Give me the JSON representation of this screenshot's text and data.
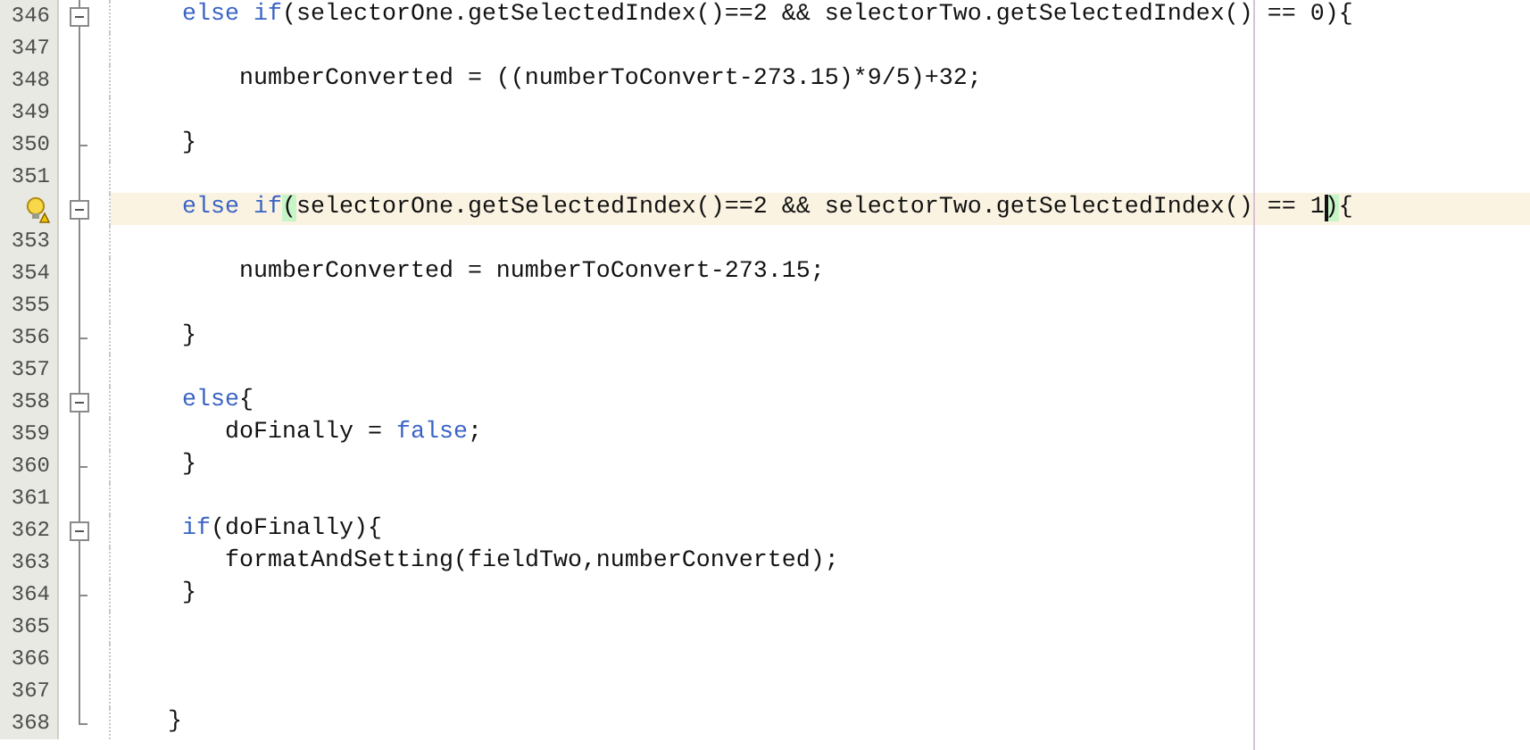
{
  "editor": {
    "lines": [
      {
        "number": "346",
        "expanded": true,
        "code": [
          {
            "text": "     else if",
            "kind": "keyword"
          },
          {
            "text": "(selectorOne.getSelectedIndex()==2 && selectorTwo.getSelectedIndex() == 0){",
            "kind": "plain"
          }
        ]
      },
      {
        "number": "347"
      },
      {
        "number": "348",
        "code": [
          {
            "text": "         numberConverted = ((numberToConvert-273.15)*9/5)+32;",
            "kind": "plain"
          }
        ]
      },
      {
        "number": "349"
      },
      {
        "number": "350",
        "block_end": true,
        "code": [
          {
            "text": "     }",
            "kind": "plain"
          }
        ]
      },
      {
        "number": "351"
      },
      {
        "hint": true,
        "current": true,
        "expanded": true,
        "code": [
          {
            "text": "     else if",
            "kind": "keyword"
          },
          {
            "text": "(",
            "kind": "match",
            "caret": false
          },
          {
            "text": "selectorOne.getSelectedIndex()==2 && selectorTwo.getSelectedIndex() == 1",
            "kind": "plain"
          },
          {
            "text": ")",
            "kind": "match",
            "caret": true
          },
          {
            "text": "{",
            "kind": "plain"
          }
        ]
      },
      {
        "number": "353"
      },
      {
        "number": "354",
        "code": [
          {
            "text": "         numberConverted = numberToConvert-273.15;",
            "kind": "plain"
          }
        ]
      },
      {
        "number": "355"
      },
      {
        "number": "356",
        "block_end": true,
        "code": [
          {
            "text": "     }",
            "kind": "plain"
          }
        ]
      },
      {
        "number": "357"
      },
      {
        "number": "358",
        "expanded": true,
        "code": [
          {
            "text": "     else",
            "kind": "keyword"
          },
          {
            "text": "{",
            "kind": "plain"
          }
        ]
      },
      {
        "number": "359",
        "code": [
          {
            "text": "        doFinally = ",
            "kind": "plain"
          },
          {
            "text": "false",
            "kind": "keyword"
          },
          {
            "text": ";",
            "kind": "plain"
          }
        ]
      },
      {
        "number": "360",
        "block_end": true,
        "code": [
          {
            "text": "     }",
            "kind": "plain"
          }
        ]
      },
      {
        "number": "361"
      },
      {
        "number": "362",
        "expanded": true,
        "code": [
          {
            "text": "     if",
            "kind": "keyword"
          },
          {
            "text": "(doFinally){",
            "kind": "plain"
          }
        ]
      },
      {
        "number": "363",
        "code": [
          {
            "text": "        formatAndSetting(fieldTwo,numberConverted);",
            "kind": "plain"
          }
        ]
      },
      {
        "number": "364",
        "block_end": true,
        "code": [
          {
            "text": "     }",
            "kind": "plain"
          }
        ]
      },
      {
        "number": "365"
      },
      {
        "number": "366"
      },
      {
        "number": "367"
      },
      {
        "number": "368",
        "block_end": true,
        "code": [
          {
            "text": "    }",
            "kind": "plain"
          }
        ]
      }
    ]
  }
}
